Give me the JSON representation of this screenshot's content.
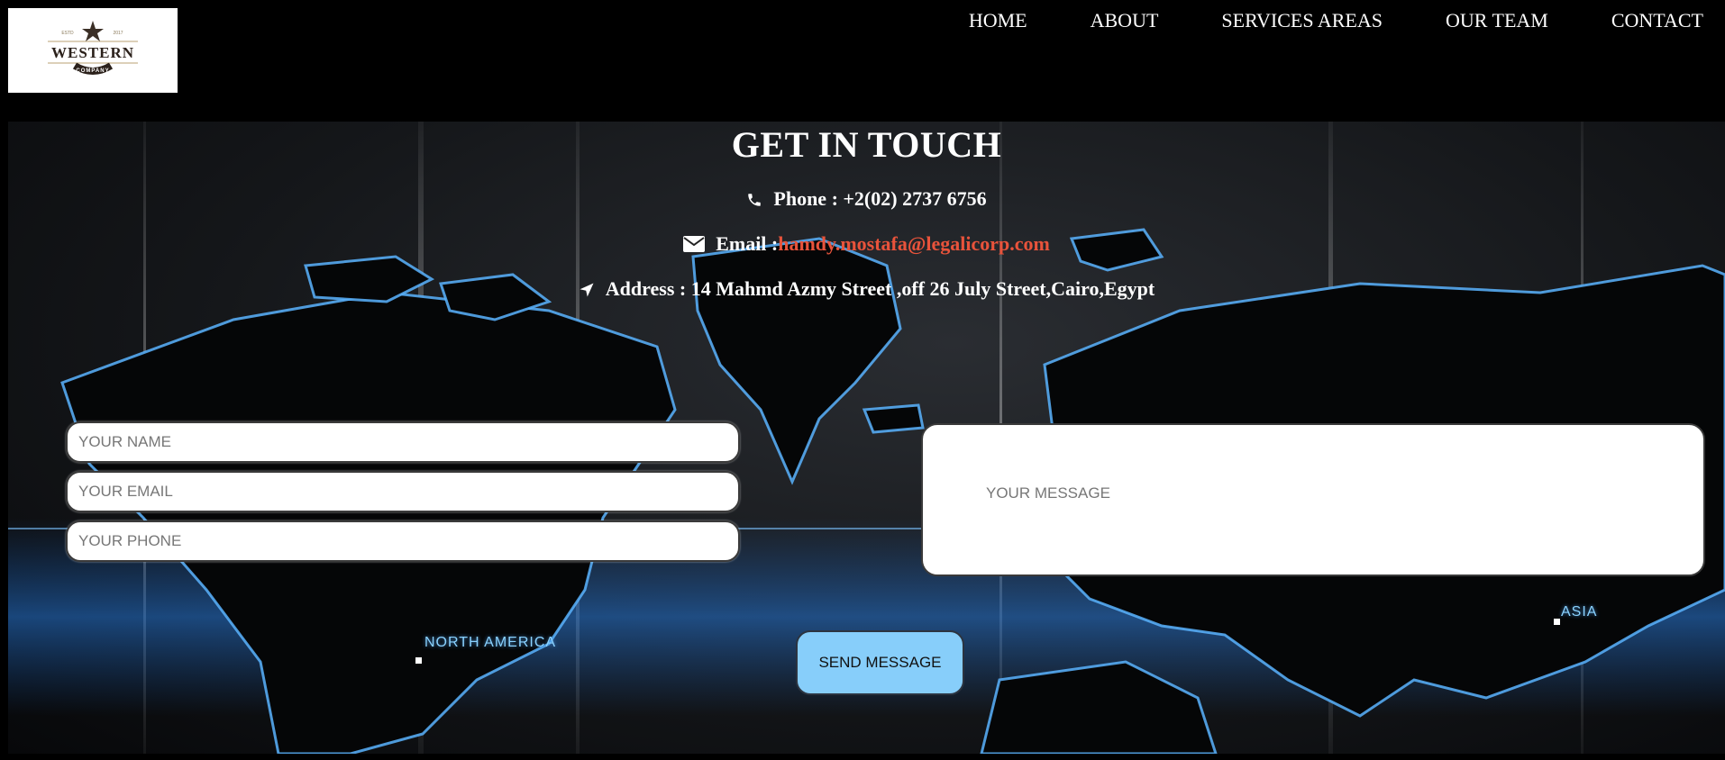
{
  "brand": {
    "logo_top_left": "ESTD",
    "logo_top_right": "2017",
    "logo_main": "WESTERN",
    "logo_sub": "COMPANY"
  },
  "nav": {
    "items": [
      {
        "label": "HOME"
      },
      {
        "label": "ABOUT"
      },
      {
        "label": "SERVICES AREAS"
      },
      {
        "label": "OUR TEAM"
      },
      {
        "label": "CONTACT"
      }
    ]
  },
  "contact": {
    "title": "GET IN TOUCH",
    "phone_label": "Phone : +2(02) 2737 6756",
    "email_label": "Email :",
    "email_value": "hamdy.mostafa@legalicorp.com",
    "address_label": "Address : 14 Mahmd Azmy Street ,off 26 July Street,Cairo,Egypt"
  },
  "form": {
    "name_placeholder": "YOUR NAME",
    "email_placeholder": "YOUR EMAIL",
    "phone_placeholder": "YOUR PHONE",
    "message_placeholder": "YOUR MESSAGE",
    "send_label": "SEND MESSAGE"
  },
  "map": {
    "north_america_label": "NORTH AMERICA",
    "asia_label": "ASIA"
  },
  "colors": {
    "background": "#000000",
    "link": "#e8533b",
    "button": "#87cefa",
    "map_glow": "#5ab4ff"
  }
}
